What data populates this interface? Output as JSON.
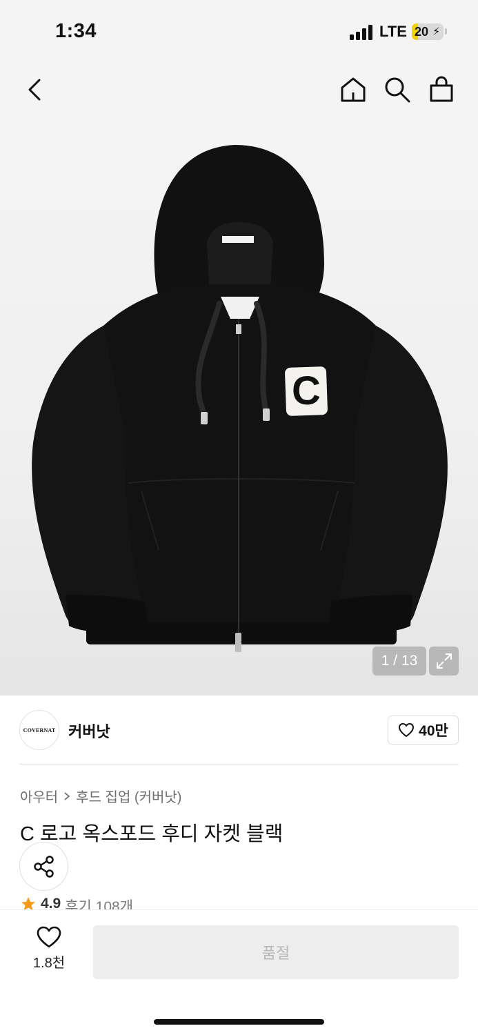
{
  "status_bar": {
    "time": "1:34",
    "network": "LTE",
    "battery": "20"
  },
  "nav": {
    "icons": [
      "chevron-left-icon",
      "home-icon",
      "search-icon",
      "shopping-bag-icon"
    ]
  },
  "gallery": {
    "counter": "1 / 13",
    "image_logo_text": "C"
  },
  "brand": {
    "logo_text": "COVERNAT",
    "name": "커버낫",
    "likes": "40만"
  },
  "breadcrumb": {
    "category": "아우터",
    "subcategory": "후드 집업 (커버낫)"
  },
  "product": {
    "title": "C 로고 옥스포드 후디 자켓 블랙",
    "rating": "4.9",
    "reviews": "후기 108개"
  },
  "bottom_bar": {
    "wish_count": "1.8천",
    "action_label": "품절"
  },
  "colors": {
    "accent_star": "#f59a1b",
    "soldout_bg": "#ededed"
  }
}
